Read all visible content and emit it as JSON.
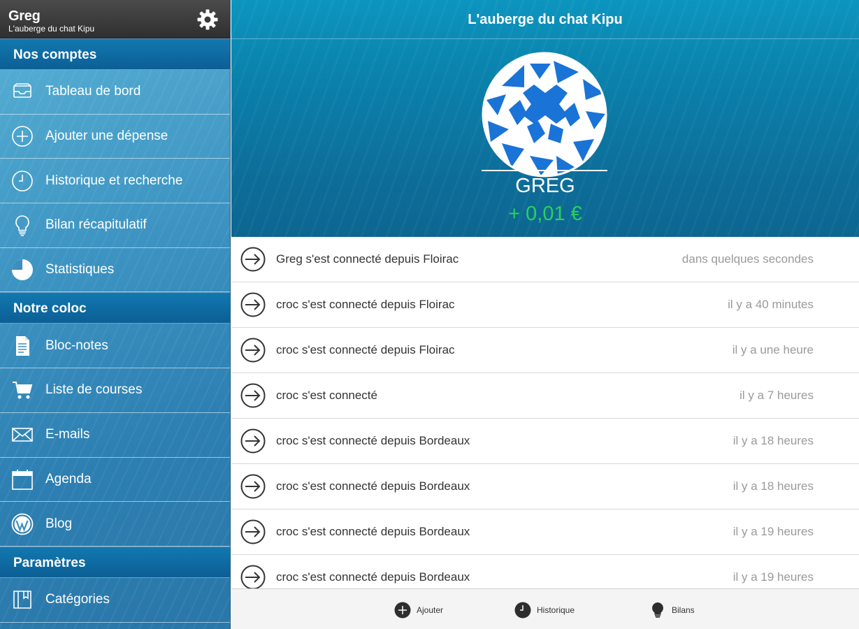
{
  "profile": {
    "name": "Greg",
    "subtitle": "L'auberge du chat Kipu"
  },
  "sidebar": {
    "sections": [
      {
        "title": "Nos comptes"
      },
      {
        "title": "Notre coloc"
      },
      {
        "title": "Paramètres"
      }
    ],
    "items": [
      {
        "label": "Tableau de bord",
        "icon": "inbox-icon"
      },
      {
        "label": "Ajouter une dépense",
        "icon": "plus-circle-icon"
      },
      {
        "label": "Historique et recherche",
        "icon": "clock-icon"
      },
      {
        "label": "Bilan récapitulatif",
        "icon": "lightbulb-icon"
      },
      {
        "label": "Statistiques",
        "icon": "pie-chart-icon"
      },
      {
        "label": "Bloc-notes",
        "icon": "document-icon"
      },
      {
        "label": "Liste de courses",
        "icon": "cart-icon"
      },
      {
        "label": "E-mails",
        "icon": "envelope-icon"
      },
      {
        "label": "Agenda",
        "icon": "calendar-icon"
      },
      {
        "label": "Blog",
        "icon": "wordpress-icon"
      },
      {
        "label": "Catégories",
        "icon": "book-icon"
      }
    ]
  },
  "hero": {
    "title": "L'auberge du chat Kipu",
    "user": "GREG",
    "balance": "+ 0,01 €",
    "balance_color": "#2bd05a"
  },
  "activity": [
    {
      "text": "Greg s'est connecté depuis Floirac",
      "time": "dans quelques secondes"
    },
    {
      "text": "croc s'est connecté depuis Floirac",
      "time": "il y a 40 minutes"
    },
    {
      "text": "croc s'est connecté depuis Floirac",
      "time": "il y a une heure"
    },
    {
      "text": "croc s'est connecté",
      "time": "il y a 7 heures"
    },
    {
      "text": "croc s'est connecté depuis Bordeaux",
      "time": "il y a 18 heures"
    },
    {
      "text": "croc s'est connecté depuis Bordeaux",
      "time": "il y a 18 heures"
    },
    {
      "text": "croc s'est connecté depuis Bordeaux",
      "time": "il y a 19 heures"
    },
    {
      "text": "croc s'est connecté depuis Bordeaux",
      "time": "il y a 19 heures"
    }
  ],
  "tabbar": {
    "add_label": "Ajouter",
    "history_label": "Historique",
    "reports_label": "Bilans"
  }
}
